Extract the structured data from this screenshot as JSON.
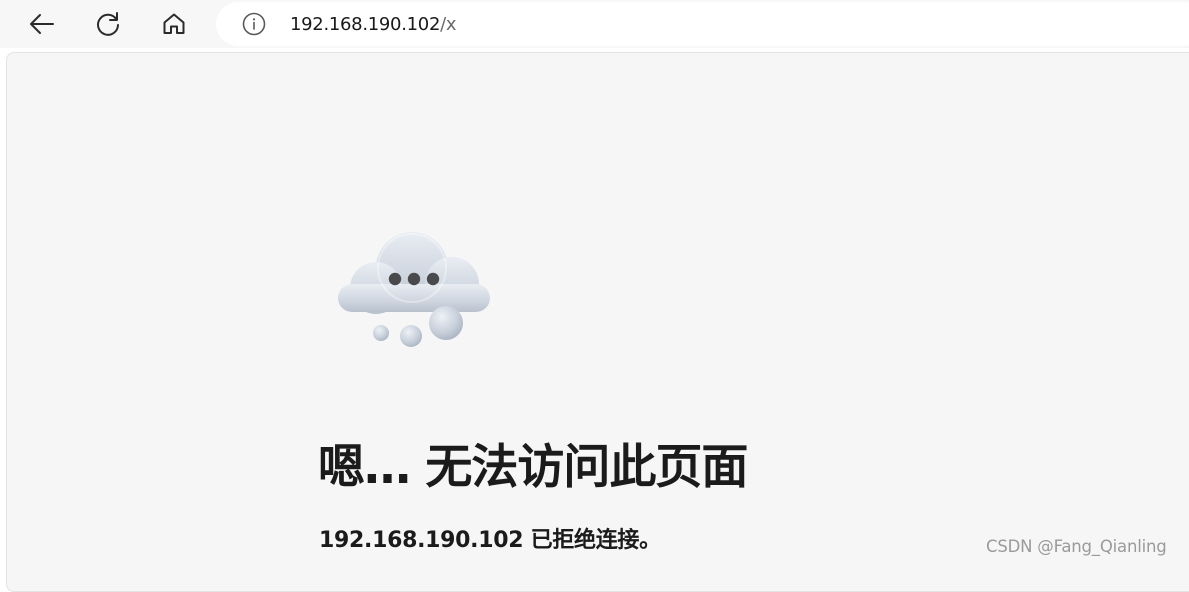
{
  "browser": {
    "url_host": "192.168.190.102",
    "url_path": "/x",
    "icons": {
      "back": "back-arrow-icon",
      "refresh": "refresh-icon",
      "home": "home-icon",
      "info": "info-icon"
    }
  },
  "error_page": {
    "illustration": "cloud-icon",
    "title": "嗯… 无法访问此页面",
    "detail": "192.168.190.102 已拒绝连接。"
  },
  "watermark": "CSDN @Fang_Qianling",
  "colors": {
    "toolbar_bg": "#f7f7f7",
    "content_bg": "#f6f6f6",
    "text": "#1b1b1b",
    "watermark": "#9a9a9a"
  }
}
